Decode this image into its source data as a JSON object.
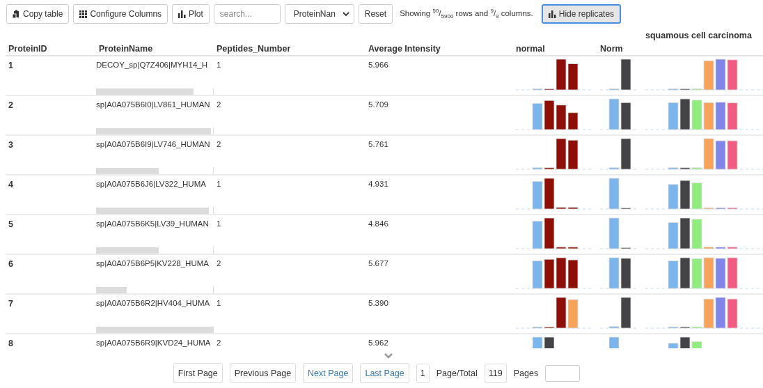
{
  "toolbar": {
    "buttons": [
      {
        "kind": "copy",
        "label": "Copy table"
      },
      {
        "kind": "columns",
        "label": "Configure Columns"
      },
      {
        "kind": "plot",
        "label": "Plot"
      }
    ],
    "search": {
      "placeholder": "search..."
    },
    "column_select": {
      "value": "ProteinNan"
    },
    "reset": {
      "label": "Reset"
    },
    "summary": "Showing $^{50}$/$_{5900}$ rows and $^{9}$/$_{9}$ columns.",
    "replicates_button": {
      "label": "Hide replicates",
      "focused": true
    }
  },
  "table": {
    "group_title": "squamous cell carcinoma",
    "columns": [
      "ProteinID",
      "ProteinName",
      "Peptides_Number",
      "Average Intensity",
      "normal",
      "Norm"
    ],
    "rows": [
      {
        "id": "1",
        "name": "DECOY_sp|Q7Z406|MYH14_H",
        "peptides": "1",
        "intensity": "5.966"
      },
      {
        "id": "2",
        "name": "sp|A0A075B6I0|LV861_HUMAN",
        "peptides": "2",
        "intensity": "5.709"
      },
      {
        "id": "3",
        "name": "sp|A0A075B6I9|LV746_HUMAN",
        "peptides": "2",
        "intensity": "5.761"
      },
      {
        "id": "4",
        "name": "sp|A0A075B6J6|LV322_HUMA",
        "peptides": "1",
        "intensity": "4.931"
      },
      {
        "id": "5",
        "name": "sp|A0A075B6K5|LV39_HUMAN",
        "peptides": "1",
        "intensity": "4.846"
      },
      {
        "id": "6",
        "name": "sp|A0A075B6P5|KV228_HUMA",
        "peptides": "2",
        "intensity": "5.677"
      },
      {
        "id": "7",
        "name": "sp|A0A075B6R2|HV404_HUMA",
        "peptides": "1",
        "intensity": "5.390"
      },
      {
        "id": "8",
        "name": "sp|A0A075B6R9|KVD24_HUMA",
        "peptides": "2",
        "intensity": "5.962"
      }
    ]
  },
  "pagination": {
    "buttons": [
      {
        "label": "First Page",
        "disabled": true
      },
      {
        "label": "Previous Page",
        "disabled": true
      },
      {
        "label": "Next Page",
        "disabled": false
      },
      {
        "label": "Last Page",
        "disabled": false
      }
    ],
    "current_page": "1",
    "total_label": "Page/Total",
    "total": "119",
    "pages_label": "Pages"
  }
}
